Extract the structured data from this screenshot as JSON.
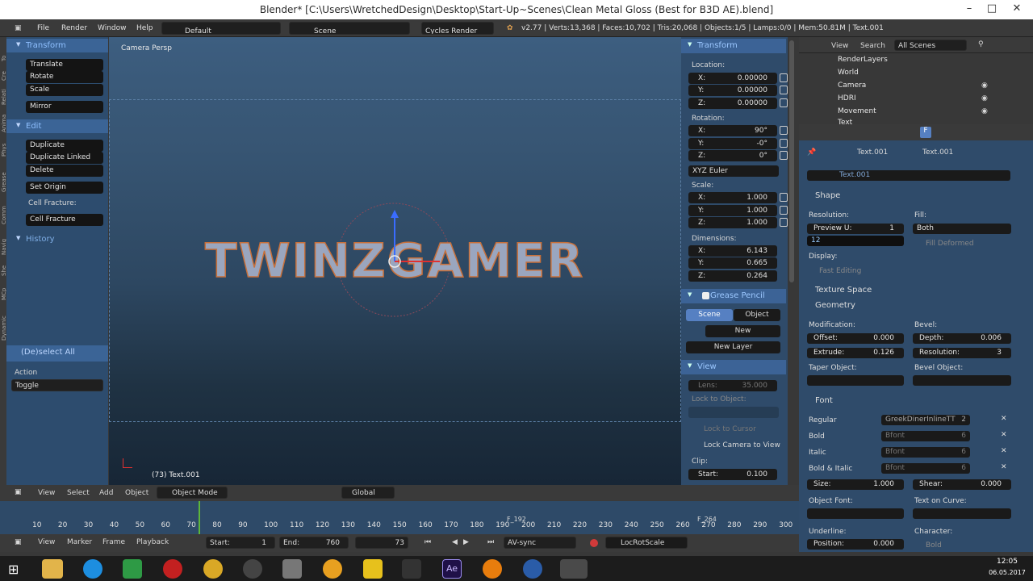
{
  "title": "Blender* [C:\\Users\\WretchedDesign\\Desktop\\Start-Up~Scenes\\Clean Metal Gloss (Best for B3D AE).blend]",
  "menus": [
    "File",
    "Render",
    "Window",
    "Help"
  ],
  "screen_layout": "Default",
  "scene": "Scene",
  "engine": "Cycles Render",
  "stats": "v2.77 | Verts:13,368 | Faces:10,702 | Tris:20,068 | Objects:1/5 | Lamps:0/0 | Mem:50.81M | Text.001",
  "toolshelf": {
    "tabs": [
      "To",
      "Cre",
      "Relati",
      "Anima",
      "Phys",
      "Grease P",
      "Comm",
      "Navig",
      "She",
      "MCp",
      "Dynamic"
    ],
    "transform_title": "Transform",
    "transform_buttons": [
      "Translate",
      "Rotate",
      "Scale",
      "Mirror"
    ],
    "edit_title": "Edit",
    "edit_buttons": [
      "Duplicate",
      "Duplicate Linked",
      "Delete"
    ],
    "set_origin": "Set Origin",
    "cell_fracture_label": "Cell Fracture:",
    "cell_fracture_button": "Cell Fracture",
    "history_title": "History",
    "operator_title": "(De)select All",
    "action_label": "Action",
    "action_value": "Toggle"
  },
  "viewport": {
    "view_label": "Camera Persp",
    "text_object": "TWINZGAMER",
    "status": "(73) Text.001"
  },
  "npanel": {
    "transform_title": "Transform",
    "location_label": "Location:",
    "loc_x": "0.00000",
    "loc_y": "0.00000",
    "loc_z": "0.00000",
    "rotation_label": "Rotation:",
    "rot_x": "90°",
    "rot_y": "-0°",
    "rot_z": "0°",
    "rot_mode": "XYZ Euler",
    "scale_label": "Scale:",
    "scale_x": "1.000",
    "scale_y": "1.000",
    "scale_z": "1.000",
    "dimensions_label": "Dimensions:",
    "dim_x": "6.143",
    "dim_y": "0.665",
    "dim_z": "0.264",
    "grease_title": "Grease Pencil",
    "gp_scene": "Scene",
    "gp_object": "Object",
    "gp_new": "New",
    "gp_new_layer": "New Layer",
    "view_title": "View",
    "lens_label": "Lens:",
    "lens": "35.000",
    "lock_to_object": "Lock to Object:",
    "lock_to_cursor": "Lock to Cursor",
    "lock_camera": "Lock Camera to View",
    "clip_label": "Clip:",
    "clip_start_label": "Start:",
    "clip_start": "0.100"
  },
  "outliner": {
    "view": "View",
    "search": "Search",
    "filter": "All Scenes",
    "items": [
      "RenderLayers",
      "World",
      "Camera",
      "HDRI",
      "Movement",
      "Text"
    ]
  },
  "props": {
    "breadcrumb1": "Text.001",
    "breadcrumb2": "Text.001",
    "datablock": "Text.001",
    "shape_title": "Shape",
    "resolution_label": "Resolution:",
    "preview_u_label": "Preview U:",
    "preview_u": "1",
    "render_u_editing": "12",
    "fill_label": "Fill:",
    "fill_value": "Both",
    "fill_deformed": "Fill Deformed",
    "display_label": "Display:",
    "fast_editing": "Fast Editing",
    "texture_space": "Texture Space",
    "geometry_title": "Geometry",
    "modification_label": "Modification:",
    "bevel_label": "Bevel:",
    "offset_label": "Offset:",
    "offset": "0.000",
    "depth_label": "Depth:",
    "depth": "0.006",
    "extrude_label": "Extrude:",
    "extrude": "0.126",
    "bevel_res_label": "Resolution:",
    "bevel_res": "3",
    "taper_label": "Taper Object:",
    "bevel_obj_label": "Bevel Object:",
    "font_title": "Font",
    "regular_label": "Regular",
    "regular_font": "GreekDinerInlineTT",
    "regular_users": "2",
    "bold_label": "Bold",
    "bold_font": "Bfont",
    "bold_users": "6",
    "italic_label": "Italic",
    "italic_font": "Bfont",
    "italic_users": "6",
    "bolditalic_label": "Bold & Italic",
    "bolditalic_font": "Bfont",
    "bolditalic_users": "6",
    "size_label": "Size:",
    "size": "1.000",
    "shear_label": "Shear:",
    "shear": "0.000",
    "object_font_label": "Object Font:",
    "text_on_curve_label": "Text on Curve:",
    "underline_label": "Underline:",
    "character_label": "Character:",
    "position_label": "Position:",
    "position": "0.000",
    "bold_char": "Bold"
  },
  "view3d_header": {
    "view": "View",
    "select": "Select",
    "add": "Add",
    "object": "Object",
    "mode": "Object Mode",
    "orientation": "Global"
  },
  "timeline": {
    "ticks": [
      "10",
      "20",
      "30",
      "40",
      "50",
      "60",
      "70",
      "80",
      "90",
      "100",
      "110",
      "120",
      "130",
      "140",
      "150",
      "160",
      "170",
      "180",
      "190",
      "200",
      "210",
      "220",
      "230",
      "240",
      "250",
      "260",
      "270",
      "280",
      "290",
      "300"
    ],
    "marker1": "F_192",
    "marker2": "F_264",
    "view": "View",
    "marker": "Marker",
    "frame": "Frame",
    "playback": "Playback",
    "start_label": "Start:",
    "start": "1",
    "end_label": "End:",
    "end": "760",
    "current": "73",
    "sync": "AV-sync",
    "keying_set": "LocRotScale"
  },
  "taskbar": {
    "time": "12:05",
    "date": "06.05.2017"
  },
  "colors": {
    "accent": "#3c6396",
    "panel": "#2f4b6a",
    "viewport_top": "#3d5e80",
    "viewport_bottom": "#172636"
  }
}
